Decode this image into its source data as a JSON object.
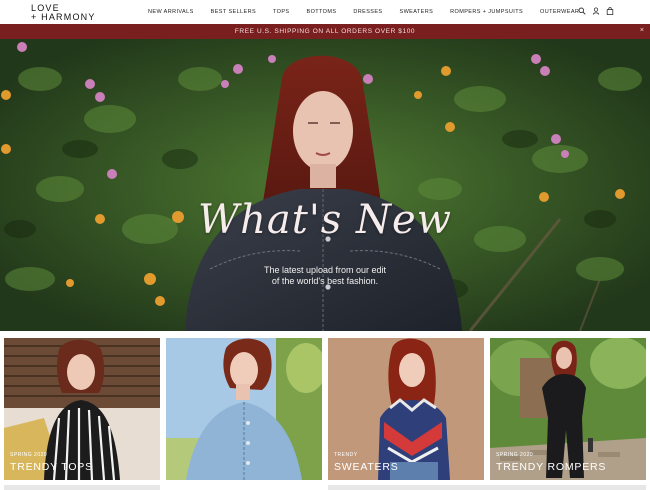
{
  "brand": {
    "line1": "LOVE",
    "line2": "+ HARMONY"
  },
  "nav": {
    "items": [
      {
        "label": "NEW ARRIVALS"
      },
      {
        "label": "BEST SELLERS"
      },
      {
        "label": "TOPS"
      },
      {
        "label": "BOTTOMS"
      },
      {
        "label": "DRESSES"
      },
      {
        "label": "SWEATERS"
      },
      {
        "label": "ROMPERS + JUMPSUITS"
      },
      {
        "label": "OUTERWEAR"
      }
    ]
  },
  "header_icons": [
    "search-icon",
    "account-icon",
    "bag-icon"
  ],
  "promo": {
    "text": "FREE U.S. SHIPPING ON ALL ORDERS OVER $100",
    "close": "×"
  },
  "hero": {
    "title": "What's New",
    "subtitle_line1": "The latest upload from our edit",
    "subtitle_line2": "of the world's best fashion."
  },
  "tiles": [
    {
      "kicker": "SPRING 2020",
      "title": "TRENDY TOPS"
    },
    {
      "kicker": "",
      "title": ""
    },
    {
      "kicker": "TRENDY",
      "title": "SWEATERS"
    },
    {
      "kicker": "SPRING 2020",
      "title": "TRENDY ROMPERS"
    }
  ],
  "colors": {
    "banner": "#7a1f1f",
    "hero_text": "#f7ecec"
  }
}
